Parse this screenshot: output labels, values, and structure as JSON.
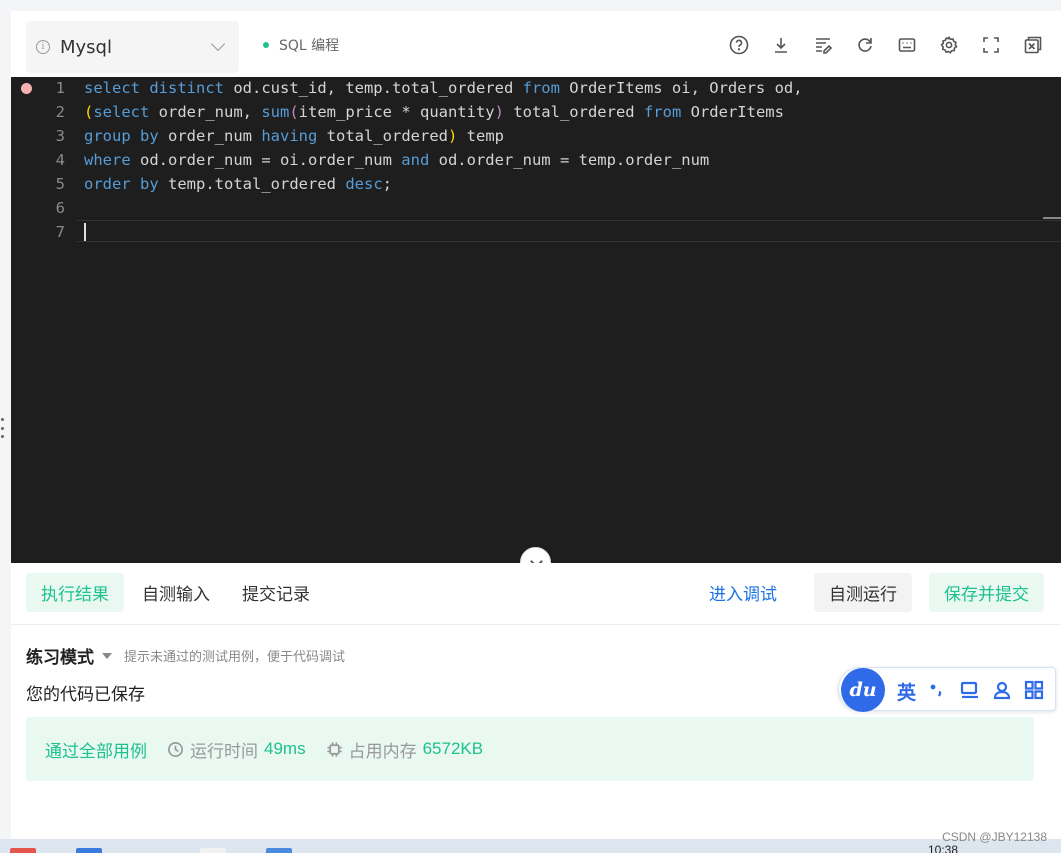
{
  "toolbar": {
    "language": "Mysql",
    "mode_label": "SQL 编程",
    "icons": [
      "help-icon",
      "download-icon",
      "format-icon",
      "refresh-icon",
      "keyboard-icon",
      "settings-icon",
      "fullscreen-icon",
      "close-window-icon"
    ]
  },
  "editor": {
    "line_numbers": [
      "1",
      "2",
      "3",
      "4",
      "5",
      "6",
      "7"
    ],
    "lines": [
      "select distinct od.cust_id, temp.total_ordered from OrderItems oi, Orders od,",
      "(select order_num, sum(item_price * quantity) total_ordered from OrderItems",
      "group by order_num having total_ordered) temp",
      "where od.order_num = oi.order_num and od.order_num = temp.order_num",
      "order by temp.total_ordered desc;",
      "",
      ""
    ]
  },
  "tabs": {
    "result": "执行结果",
    "custom_input": "自测输入",
    "history": "提交记录"
  },
  "actions": {
    "debug": "进入调试",
    "self_run": "自测运行",
    "save_submit": "保存并提交"
  },
  "practice": {
    "mode": "练习模式",
    "hint": "提示未通过的测试用例，便于代码调试"
  },
  "status": {
    "saved": "您的代码已保存",
    "pass": "通过全部用例",
    "runtime_label": "运行时间",
    "runtime_value": "49ms",
    "memory_label": "占用内存",
    "memory_value": "6572KB"
  },
  "ime": {
    "logo": "du",
    "lang": "英"
  },
  "taskbar": {
    "clock": "10:38"
  },
  "watermark": "CSDN @JBY12138",
  "colors": {
    "accent": "#1ec28b",
    "link": "#1a73e8",
    "editor_bg": "#1e1e1e",
    "keyword": "#569cd6"
  }
}
